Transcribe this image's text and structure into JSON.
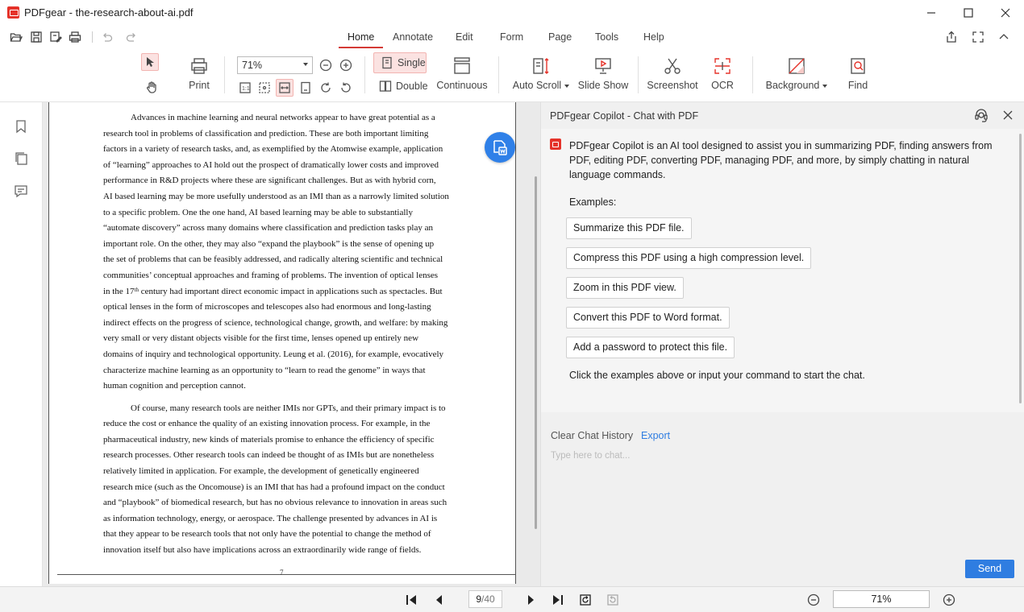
{
  "window": {
    "title": "PDFgear - the-research-about-ai.pdf"
  },
  "menu": {
    "tabs": [
      "Home",
      "Annotate",
      "Edit",
      "Form",
      "Page",
      "Tools",
      "Help"
    ],
    "active": "Home"
  },
  "ribbon": {
    "print": "Print",
    "zoom_value": "71%",
    "single": "Single",
    "double": "Double",
    "continuous": "Continuous",
    "auto_scroll": "Auto Scroll",
    "slide_show": "Slide Show",
    "screenshot": "Screenshot",
    "ocr": "OCR",
    "background": "Background",
    "find": "Find"
  },
  "document": {
    "lines": [
      "Advances in machine learning and neural networks appear to have great potential as a",
      "research tool in problems of classification and prediction.  These are both important limiting",
      "factors in a variety of research tasks, and, as exemplified by the Atomwise example, application",
      "of “learning” approaches to AI hold out the prospect of dramatically lower costs and improved",
      "performance in R&D projects where these are significant challenges.  But as with hybrid corn,",
      "AI based learning may be more usefully understood as an IMI than as a narrowly limited solution",
      "to a specific problem.  One the one hand, AI based learning may be able to substantially",
      "“automate discovery” across many domains where classification and prediction tasks play an",
      "important role.  On the other, they may also “expand the playbook” is the sense of opening up",
      "the set of problems that can be feasibly addressed, and radically altering  scientific and technical",
      "communities’ conceptual approaches and framing of problems.  The invention of optical lenses",
      "in the 17",
      "optical lenses in the form of microscopes and telescopes also had enormous and long-lasting",
      "indirect effects on the progress of science, technological change, growth, and welfare: by making",
      "very small or very distant objects visible for the first time, lenses opened up entirely new",
      "domains of inquiry and technological opportunity.  Leung et al. (2016), for example, evocatively",
      "characterize machine learning as an opportunity to “learn to read the genome” in ways that",
      "human cognition and perception cannot.",
      "Of course, many research tools are neither IMIs nor GPTs, and their primary impact is to",
      "reduce the cost or enhance the quality of an existing innovation process.  For example, in the",
      "pharmaceutical industry, new kinds of materials promise to enhance the efficiency of specific",
      "research processes.  Other research tools can indeed be thought of as IMIs but are nonetheless",
      "relatively limited in application.  For example, the development of genetically engineered",
      "research mice (such as the Oncomouse) is an IMI that has had a profound impact on the conduct",
      "and “playbook” of biomedical research, but has no obvious relevance to innovation in areas such",
      "as information technology, energy, or aerospace.  The challenge presented by advances in AI is",
      "that they appear to be research tools that not only have the potential to change the method of",
      "innovation itself but also have implications across an extraordinarily wide range of fields."
    ],
    "sup_th": "th",
    "line12_rest": " century had important direct economic impact in applications such as spectacles.  But",
    "page_number": "7"
  },
  "copilot": {
    "title": "PDFgear Copilot - Chat with PDF",
    "intro": "PDFgear Copilot is an AI tool designed to assist you in summarizing PDF, finding answers from PDF, editing PDF, converting PDF, managing PDF, and more, by simply chatting in natural language commands.",
    "examples_label": "Examples:",
    "examples": [
      "Summarize this PDF file.",
      "Compress this PDF using a high compression level.",
      "Zoom in this PDF view.",
      "Convert this PDF to Word format.",
      "Add a password to protect this file."
    ],
    "cta": "Click the examples above or input your command to start the chat.",
    "clear_history": "Clear Chat History",
    "export": "Export",
    "input_placeholder": "Type here to chat...",
    "send": "Send"
  },
  "status": {
    "current_page": "9",
    "total_pages": "/40",
    "zoom": "71%"
  },
  "colors": {
    "accent": "#2f7de1",
    "brand": "#e5332a",
    "active_tab": "#d43a35"
  }
}
